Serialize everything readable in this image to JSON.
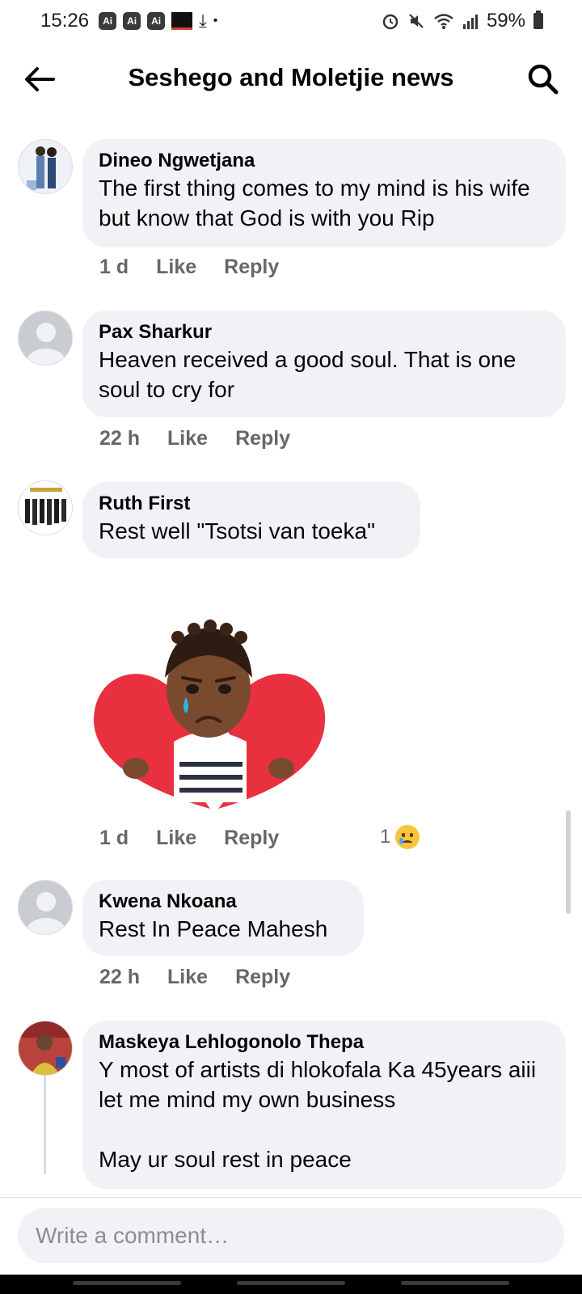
{
  "status_bar": {
    "time": "15:26",
    "ai_labels": [
      "Ai",
      "Ai",
      "Ai"
    ],
    "battery": "59%"
  },
  "header": {
    "title": "Seshego and Moletjie news",
    "back_icon": "arrow-left-icon",
    "search_icon": "search-icon"
  },
  "comments": [
    {
      "author": "Dineo Ngwetjana",
      "text": "The first thing comes to my mind is his wife but know that God is with you Rip",
      "time": "1 d",
      "like": "Like",
      "reply": "Reply"
    },
    {
      "author": "Pax Sharkur",
      "text": "Heaven received a good soul. That is one soul to cry for",
      "time": "22 h",
      "like": "Like",
      "reply": "Reply"
    },
    {
      "author": "Ruth First",
      "text": "Rest well \"Tsotsi van toeka\"",
      "time": "1 d",
      "like": "Like",
      "reply": "Reply",
      "reaction_count": "1",
      "reaction_icon": "sad-face-icon"
    },
    {
      "author": "Kwena Nkoana",
      "text": "Rest In Peace Mahesh",
      "time": "22 h",
      "like": "Like",
      "reply": "Reply"
    },
    {
      "author": "Maskeya Lehlogonolo Thepa",
      "text": "Y most of artists di hlokofala Ka 45years aiii let me mind my own business\n\nMay ur soul rest in peace"
    }
  ],
  "composer": {
    "placeholder": "Write a comment…"
  },
  "colors": {
    "bubble": "#f0f2f5",
    "meta_text": "#65676b",
    "heart": "#e8303f"
  }
}
